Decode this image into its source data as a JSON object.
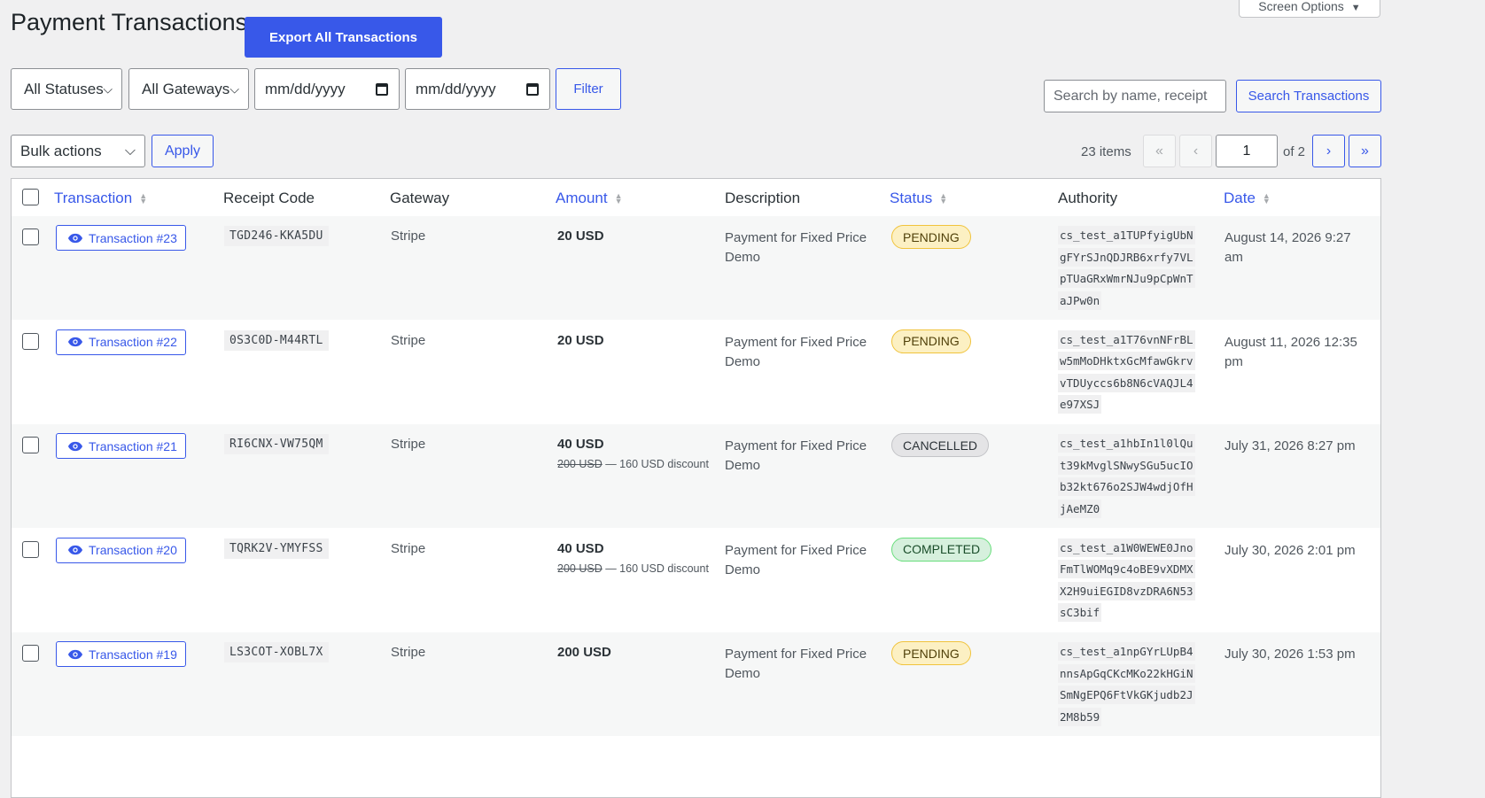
{
  "header": {
    "title": "Payment Transactions",
    "export_label": "Export All Transactions",
    "screen_options_label": "Screen Options"
  },
  "filters": {
    "status_selected": "All Statuses",
    "gateway_selected": "All Gateways",
    "date_from_placeholder": "mm/dd/yyyy",
    "date_to_placeholder": "mm/dd/yyyy",
    "filter_label": "Filter"
  },
  "search": {
    "placeholder": "Search by name, receipt",
    "button_label": "Search Transactions"
  },
  "bulk": {
    "selected": "Bulk actions",
    "apply_label": "Apply"
  },
  "pagination": {
    "items_count": "23 items",
    "first": "«",
    "prev": "‹",
    "current_page": "1",
    "of_total": "of 2",
    "next": "›",
    "last": "»"
  },
  "table": {
    "columns": {
      "transaction": "Transaction",
      "receipt_code": "Receipt Code",
      "gateway": "Gateway",
      "amount": "Amount",
      "description": "Description",
      "status": "Status",
      "authority": "Authority",
      "date": "Date"
    },
    "rows": [
      {
        "transaction": "Transaction #23",
        "receipt_code": "TGD246-KKA5DU",
        "gateway": "Stripe",
        "amount": "20 USD",
        "original_amount": "",
        "discount_text": "",
        "description": "Payment for Fixed Price Demo",
        "status": "PENDING",
        "status_type": "pending",
        "authority": " cs_test_a1TUPfyigUbNgFYrSJnQDJRB6xrfy7VLpTUaGRxWmrNJu9pCpWnTaJPw0n",
        "date": "August 14, 2026 9:27 am"
      },
      {
        "transaction": "Transaction #22",
        "receipt_code": "0S3C0D-M44RTL",
        "gateway": "Stripe",
        "amount": "20 USD",
        "original_amount": "",
        "discount_text": "",
        "description": "Payment for Fixed Price Demo",
        "status": "PENDING",
        "status_type": "pending",
        "authority": " cs_test_a1T76vnNFrBLw5mMoDHktxGcMfawGkrvvTDUyccs6b8N6cVAQJL4e97XSJ",
        "date": "August 11, 2026 12:35 pm"
      },
      {
        "transaction": "Transaction #21",
        "receipt_code": "RI6CNX-VW75QM",
        "gateway": "Stripe",
        "amount": "40 USD",
        "original_amount": "200 USD",
        "discount_text": " — 160 USD discount",
        "description": "Payment for Fixed Price Demo",
        "status": "CANCELLED",
        "status_type": "cancelled",
        "authority": " cs_test_a1hbIn1l0lQut39kMvglSNwySGu5ucIOb32kt676o2SJW4wdjOfHjAeMZ0",
        "date": "July 31, 2026 8:27 pm"
      },
      {
        "transaction": "Transaction #20",
        "receipt_code": "TQRK2V-YMYFSS",
        "gateway": "Stripe",
        "amount": "40 USD",
        "original_amount": "200 USD",
        "discount_text": " — 160 USD discount",
        "description": "Payment for Fixed Price Demo",
        "status": "COMPLETED",
        "status_type": "completed",
        "authority": " cs_test_a1W0WEWE0JnoFmTlWOMq9c4oBE9vXDMXX2H9uiEGID8vzDRA6N53sC3bif",
        "date": "July 30, 2026 2:01 pm"
      },
      {
        "transaction": "Transaction #19",
        "receipt_code": "LS3COT-XOBL7X",
        "gateway": "Stripe",
        "amount": "200 USD",
        "original_amount": "",
        "discount_text": "",
        "description": "Payment for Fixed Price Demo",
        "status": "PENDING",
        "status_type": "pending",
        "authority": " cs_test_a1npGYrLUpB4nnsApGqCKcMKo22kHGiNSmNgEPQ6FtVkGKjudb2J2M8b59",
        "date": "July 30, 2026 1:53 pm"
      }
    ]
  },
  "colors": {
    "accent": "#3858e9",
    "pending_bg": "#fcf0c3",
    "cancelled_bg": "#e4e4e6",
    "completed_bg": "#d6f0dd"
  }
}
